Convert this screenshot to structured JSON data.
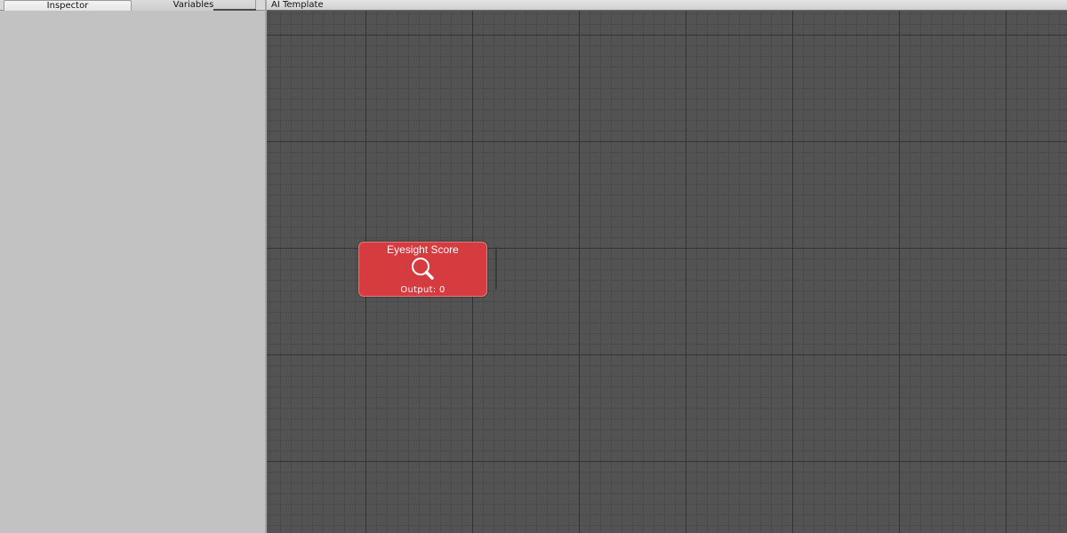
{
  "left_panel": {
    "tabs": [
      {
        "label": "Inspector",
        "active": true
      },
      {
        "label": "Variables",
        "active": false
      }
    ]
  },
  "graph": {
    "title": "AI Template",
    "background_color": "#535353",
    "node": {
      "title": "Eyesight Score",
      "icon": "magnifier-icon",
      "output_label": "Output: 0",
      "color": "#d63b3f"
    }
  }
}
